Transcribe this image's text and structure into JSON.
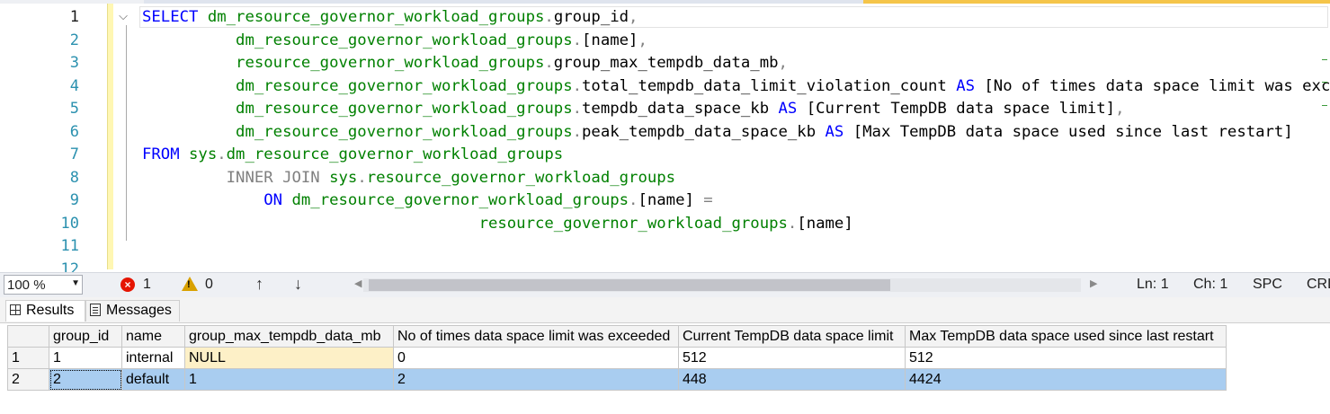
{
  "editor": {
    "line_numbers": [
      "1",
      "2",
      "3",
      "4",
      "5",
      "6",
      "7",
      "8",
      "9",
      "10",
      "11",
      "12"
    ],
    "lines": [
      [
        {
          "t": "SELECT ",
          "c": "kw"
        },
        {
          "t": "dm_resource_governor_workload_groups",
          "c": "obj"
        },
        {
          "t": ".",
          "c": "gray"
        },
        {
          "t": "group_id",
          "c": "plain"
        },
        {
          "t": ",",
          "c": "gray"
        }
      ],
      [
        {
          "t": "          ",
          "c": "plain"
        },
        {
          "t": "dm_resource_governor_workload_groups",
          "c": "obj"
        },
        {
          "t": ".",
          "c": "gray"
        },
        {
          "t": "[name]",
          "c": "plain"
        },
        {
          "t": ",",
          "c": "gray"
        }
      ],
      [
        {
          "t": "          ",
          "c": "plain"
        },
        {
          "t": "resource_governor_workload_groups",
          "c": "obj"
        },
        {
          "t": ".",
          "c": "gray"
        },
        {
          "t": "group_max_tempdb_data_mb",
          "c": "plain"
        },
        {
          "t": ",",
          "c": "gray"
        }
      ],
      [
        {
          "t": "          ",
          "c": "plain"
        },
        {
          "t": "dm_resource_governor_workload_groups",
          "c": "obj"
        },
        {
          "t": ".",
          "c": "gray"
        },
        {
          "t": "total_tempdb_data_limit_violation_count ",
          "c": "plain"
        },
        {
          "t": "AS",
          "c": "kw"
        },
        {
          "t": " [No of times data space limit was exceeded]",
          "c": "plain"
        }
      ],
      [
        {
          "t": "          ",
          "c": "plain"
        },
        {
          "t": "dm_resource_governor_workload_groups",
          "c": "obj"
        },
        {
          "t": ".",
          "c": "gray"
        },
        {
          "t": "tempdb_data_space_kb ",
          "c": "plain"
        },
        {
          "t": "AS",
          "c": "kw"
        },
        {
          "t": " [Current TempDB data space limit]",
          "c": "plain"
        },
        {
          "t": ",",
          "c": "gray"
        }
      ],
      [
        {
          "t": "          ",
          "c": "plain"
        },
        {
          "t": "dm_resource_governor_workload_groups",
          "c": "obj"
        },
        {
          "t": ".",
          "c": "gray"
        },
        {
          "t": "peak_tempdb_data_space_kb ",
          "c": "plain"
        },
        {
          "t": "AS",
          "c": "kw"
        },
        {
          "t": " [Max TempDB data space used since last restart]",
          "c": "plain"
        }
      ],
      [
        {
          "t": "FROM ",
          "c": "kw"
        },
        {
          "t": "sys",
          "c": "obj"
        },
        {
          "t": ".",
          "c": "gray"
        },
        {
          "t": "dm_resource_governor_workload_groups",
          "c": "obj"
        }
      ],
      [
        {
          "t": "         ",
          "c": "plain"
        },
        {
          "t": "INNER JOIN ",
          "c": "gray"
        },
        {
          "t": "sys",
          "c": "obj"
        },
        {
          "t": ".",
          "c": "gray"
        },
        {
          "t": "resource_governor_workload_groups",
          "c": "obj"
        }
      ],
      [
        {
          "t": "             ",
          "c": "plain"
        },
        {
          "t": "ON ",
          "c": "kw"
        },
        {
          "t": "dm_resource_governor_workload_groups",
          "c": "obj"
        },
        {
          "t": ".",
          "c": "gray"
        },
        {
          "t": "[name] ",
          "c": "plain"
        },
        {
          "t": "=",
          "c": "gray"
        }
      ],
      [
        {
          "t": "                                    ",
          "c": "plain"
        },
        {
          "t": "resource_governor_workload_groups",
          "c": "obj"
        },
        {
          "t": ".",
          "c": "gray"
        },
        {
          "t": "[name]",
          "c": "plain"
        }
      ],
      [],
      []
    ]
  },
  "statusbar": {
    "zoom": "100 %",
    "errors": "1",
    "warnings": "0",
    "up_arrow": "↑",
    "down_arrow": "↓",
    "ln": "Ln: 1",
    "ch": "Ch: 1",
    "spc": "SPC",
    "crlf": "CRLF"
  },
  "tabs": {
    "results": "Results",
    "messages": "Messages"
  },
  "grid": {
    "columns": [
      "group_id",
      "name",
      "group_max_tempdb_data_mb",
      "No of times data space limit was exceeded",
      "Current TempDB data space limit",
      "Max TempDB data space used since last restart"
    ],
    "rows": [
      {
        "num": "1",
        "cells": [
          "1",
          "internal",
          "NULL",
          "0",
          "512",
          "512"
        ]
      },
      {
        "num": "2",
        "cells": [
          "2",
          "default",
          "1",
          "2",
          "448",
          "4424"
        ]
      }
    ]
  },
  "colors": {
    "keyword": "#0000ff",
    "object": "#008000",
    "operator": "#808080",
    "selection": "#a9cdf0",
    "null_cell": "#fdf0c7"
  }
}
